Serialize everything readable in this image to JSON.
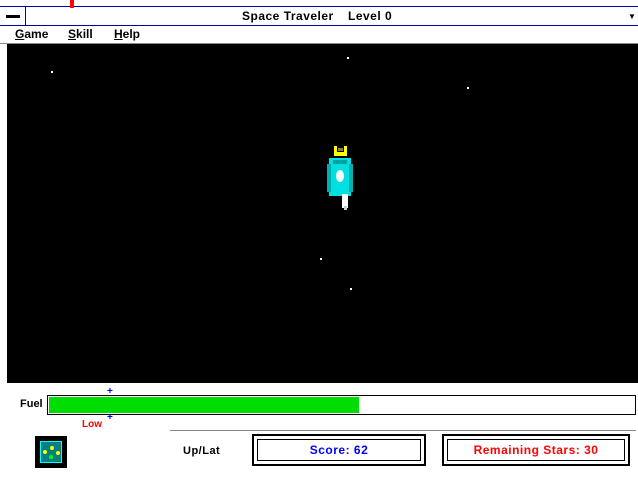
{
  "window": {
    "title": "Space Traveler",
    "level": "Level 0"
  },
  "menu": {
    "items": [
      "Game",
      "Skill",
      "Help"
    ]
  },
  "colors": {
    "space": "#000000",
    "fuel": "#00dd00",
    "score_text": "#0000ff",
    "remaining_text": "#ff0000",
    "low_text": "#ff0000"
  },
  "fuel": {
    "label": "Fuel",
    "level": 0.53,
    "low_label": "Low"
  },
  "status": {
    "mode": "Up/Lat",
    "score": "Score: 62",
    "remaining": "Remaining Stars: 30"
  }
}
